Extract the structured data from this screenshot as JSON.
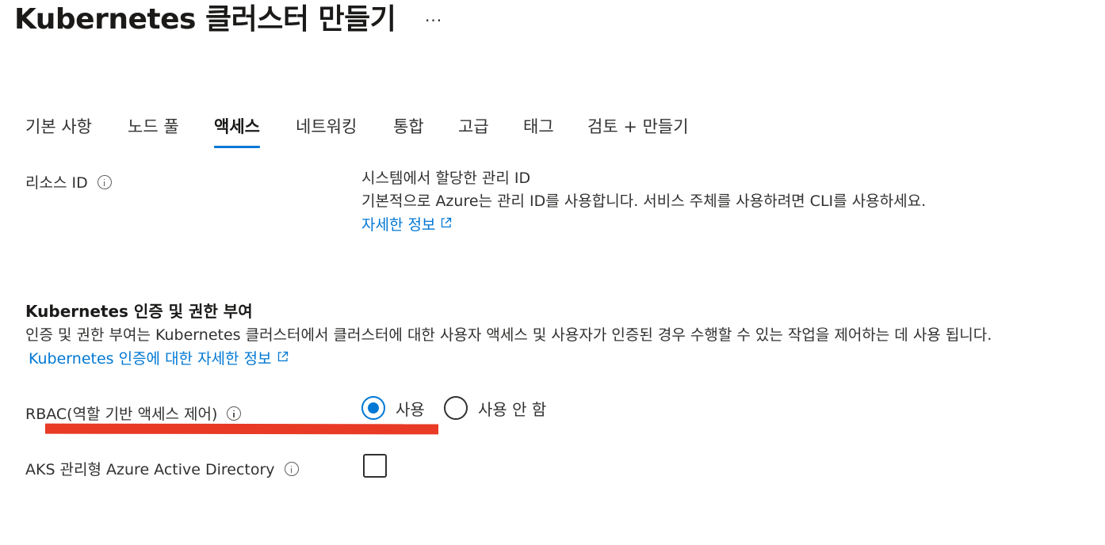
{
  "header": {
    "title": "Kubernetes 클러스터 만들기",
    "more": "···"
  },
  "tabs": [
    {
      "label": "기본 사항",
      "active": false
    },
    {
      "label": "노드 풀",
      "active": false
    },
    {
      "label": "액세스",
      "active": true
    },
    {
      "label": "네트워킹",
      "active": false
    },
    {
      "label": "통합",
      "active": false
    },
    {
      "label": "고급",
      "active": false
    },
    {
      "label": "태그",
      "active": false
    },
    {
      "label": "검토 + 만들기",
      "active": false
    }
  ],
  "resource_id": {
    "label": "리소스 ID",
    "line1": "시스템에서 할당한 관리 ID",
    "line2": "기본적으로 Azure는 관리 ID를 사용합니다. 서비스 주체를 사용하려면 CLI를 사용하세요.",
    "link": "자세한 정보"
  },
  "auth_section": {
    "title": "Kubernetes 인증 및 권한 부여",
    "description": "인증 및 권한 부여는 Kubernetes 클러스터에서 클러스터에 대한 사용자 액세스 및 사용자가 인증된 경우 수행할 수 있는 작업을 제어하는 데 사용 됩니다.",
    "link": "Kubernetes 인증에 대한 자세한 정보"
  },
  "rbac": {
    "label": "RBAC(역할 기반 액세스 제어)",
    "options": [
      {
        "label": "사용",
        "checked": true
      },
      {
        "label": "사용 안 함",
        "checked": false
      }
    ]
  },
  "aad": {
    "label": "AKS 관리형 Azure Active Directory",
    "checked": false
  },
  "colors": {
    "accent": "#0078d4",
    "annotation": "#e83a25"
  }
}
